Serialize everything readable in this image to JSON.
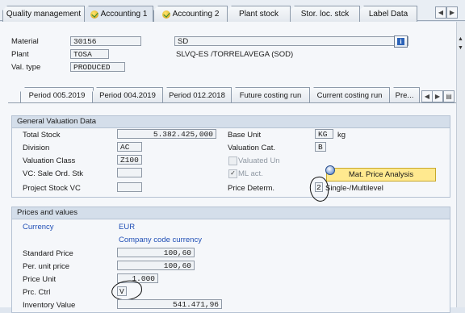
{
  "top_tabs": [
    "Quality management",
    "Accounting 1",
    "Accounting 2",
    "Plant stock",
    "Stor. loc. stck",
    "Label Data"
  ],
  "header": {
    "material_label": "Material",
    "material_value": "30156",
    "material_desc": "SD",
    "plant_label": "Plant",
    "plant_value": "TOSA",
    "plant_desc": "SLVQ-ES /TORRELAVEGA   (SOD)",
    "valtype_label": "Val. type",
    "valtype_value": "PRODUCED"
  },
  "inner_tabs": [
    "Period 005.2019",
    "Period 004.2019",
    "Period 012.2018",
    "Future costing run",
    "Current costing run",
    "Pre..."
  ],
  "general": {
    "title": "General Valuation Data",
    "total_stock_label": "Total Stock",
    "total_stock_value": "5.382.425,000",
    "base_unit_label": "Base Unit",
    "base_unit_value": "KG",
    "base_unit_text": "kg",
    "division_label": "Division",
    "division_value": "AC",
    "valcat_label": "Valuation Cat.",
    "valcat_value": "B",
    "valclass_label": "Valuation Class",
    "valclass_value": "Z100",
    "valued_un_label": "Valuated Un",
    "vc_sale_label": "VC: Sale Ord. Stk",
    "ml_act_label": "ML act.",
    "project_label": "Project Stock VC",
    "price_determ_label": "Price Determ.",
    "price_determ_value": "2",
    "price_determ_text": "Single-/Multilevel",
    "mat_price_button": "Mat. Price Analysis"
  },
  "prices": {
    "title": "Prices and values",
    "currency_label": "Currency",
    "currency_value": "EUR",
    "company_code_currency": "Company code currency",
    "std_price_label": "Standard Price",
    "std_price_value": "100,60",
    "per_unit_label": "Per. unit price",
    "per_unit_value": "100,60",
    "price_unit_label": "Price Unit",
    "price_unit_value": "1.000",
    "prc_ctrl_label": "Prc. Ctrl",
    "prc_ctrl_value": "V",
    "inventory_label": "Inventory Value",
    "inventory_value": "541.471,96"
  },
  "colors": {
    "accent_blue": "#1f4eb5",
    "group_header": "#d4deea",
    "button_yellow": "#ffe98f"
  },
  "icons": [
    "info-icon",
    "accounting-tab-icon",
    "scroll-left-icon",
    "scroll-right-icon",
    "tab-list-icon"
  ]
}
